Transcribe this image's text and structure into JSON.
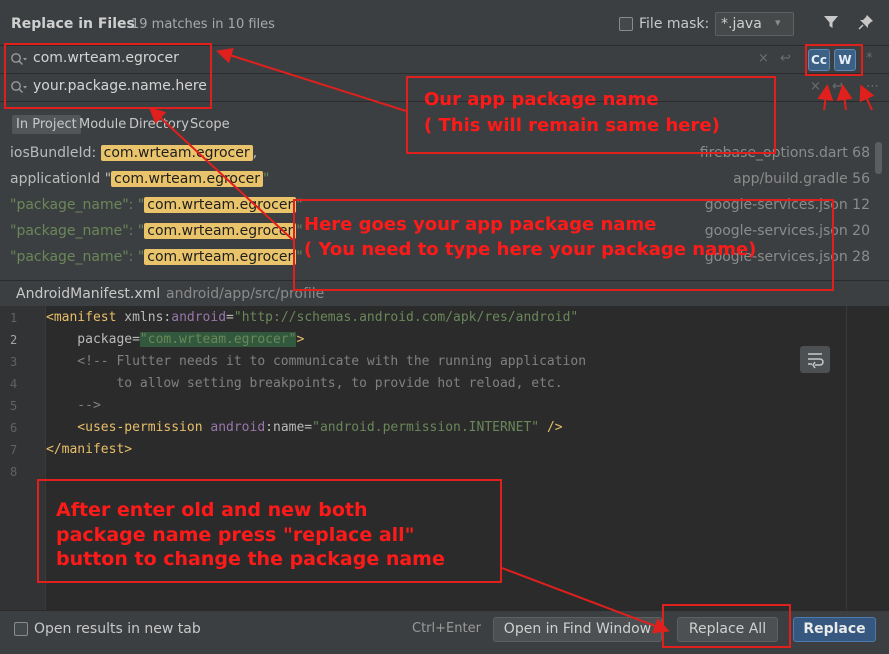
{
  "header": {
    "title": "Replace in Files",
    "match_count": "19 matches in 10 files",
    "file_mask_label": "File mask:",
    "file_mask_value": "*.java",
    "file_mask_arrow": "▾"
  },
  "find": {
    "value": "com.wrteam.egrocer",
    "clear_icon": "×",
    "regex_icon": "↩",
    "match_case": "Cc",
    "words": "W",
    "regex": "*"
  },
  "replace": {
    "value": "your.package.name.here",
    "clear_icon": "×",
    "preserve_icon": "↩",
    "extra_icon": "⋯"
  },
  "scope": {
    "tabs": [
      "In Project",
      "Module",
      "Directory",
      "Scope"
    ]
  },
  "results": [
    {
      "prefix": "iosBundleId: ",
      "match": "com.wrteam.egrocer",
      "suffix": ",",
      "file": "firebase_options.dart 68"
    },
    {
      "prefix": "applicationId \"",
      "match": "com.wrteam.egrocer",
      "suffix": "\"",
      "file": "app/build.gradle 56"
    },
    {
      "prefix": "\"package_name\": \"",
      "match": "com.wrteam.egrocer",
      "suffix": "\"",
      "file": "google-services.json 12"
    },
    {
      "prefix": "\"package_name\": \"",
      "match": "com.wrteam.egrocer",
      "suffix": "\"",
      "file": "google-services.json 20"
    },
    {
      "prefix": "\"package_name\": \"",
      "match": "com.wrteam.egrocer",
      "suffix": "\"",
      "file": "google-services.json 28"
    }
  ],
  "preview": {
    "file": "AndroidManifest.xml",
    "path": "android/app/src/profile",
    "line_numbers": [
      "1",
      "2",
      "3",
      "4",
      "5",
      "6",
      "7",
      "8"
    ],
    "lines": {
      "l1_open": "<manifest",
      "l1_attr": " xmlns:",
      "l1_ns": "android",
      "l1_eq": "=",
      "l1_str": "\"http://schemas.android.com/apk/res/android\"",
      "l2_attr": "    package=",
      "l2_str": "\"com.wrteam.egrocer\"",
      "l2_close": ">",
      "l3": "    <!-- Flutter needs it to communicate with the running application",
      "l4": "         to allow setting breakpoints, to provide hot reload, etc.",
      "l5": "    -->",
      "l6_open": "    <uses-permission ",
      "l6_ns": "android",
      "l6_attr": ":name=",
      "l6_str": "\"android.permission.INTERNET\"",
      "l6_close": " />",
      "l7": "</manifest>"
    }
  },
  "footer": {
    "open_new_tab": "Open results in new tab",
    "shortcut": "Ctrl+Enter",
    "open_find_window": "Open in Find Window",
    "replace_all": "Replace All",
    "replace": "Replace"
  },
  "annotations": {
    "package_note_line1": "Our app package name",
    "package_note_line2": "( This will remain same here)",
    "new_name_line1": "Here goes your app package name",
    "new_name_line2": "( You need to type here your package name)",
    "replace_note_line1": "After enter old and new both",
    "replace_note_line2": "package name press \"replace all\"",
    "replace_note_line3": "button to change the package name",
    "color": "#e0201c"
  },
  "colors": {
    "background": "#3c3f41",
    "editor": "#2b2b2b",
    "highlight": "#e9c46a",
    "accent_button": "#365880"
  }
}
